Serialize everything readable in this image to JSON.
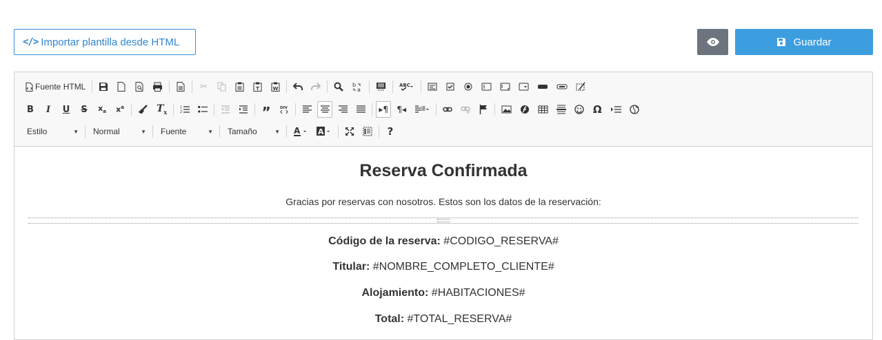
{
  "actions": {
    "import_label": "Importar plantilla desde HTML",
    "save_label": "Guardar"
  },
  "toolbar": {
    "source_label": "Fuente HTML",
    "style_combo": "Estilo",
    "format_combo": "Normal",
    "font_combo": "Fuente",
    "size_combo": "Tamaño",
    "bold": "B",
    "italic": "I",
    "underline": "U",
    "strike": "S",
    "help": "?"
  },
  "content": {
    "title": "Reserva Confirmada",
    "intro": "Gracias por reservas con nosotros. Estos son los datos de la reservación:",
    "fields": [
      {
        "label": "Código de la reserva:",
        "value": " #CODIGO_RESERVA#"
      },
      {
        "label": "Titular:",
        "value": " #NOMBRE_COMPLETO_CLIENTE#"
      },
      {
        "label": "Alojamiento:",
        "value": " #HABITACIONES#"
      },
      {
        "label": "Total:",
        "value": " #TOTAL_RESERVA#"
      }
    ]
  },
  "colors": {
    "primary": "#3d9edf",
    "secondary": "#6c757d",
    "import_border": "#3a8fd6"
  }
}
